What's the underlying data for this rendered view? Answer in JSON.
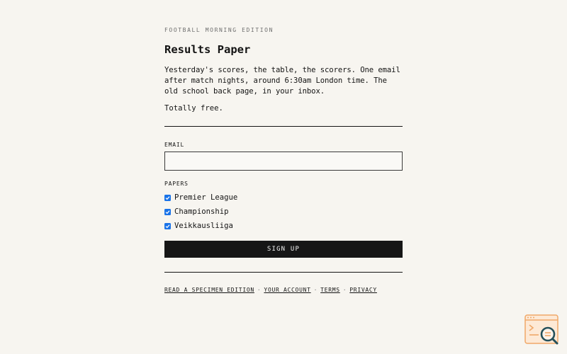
{
  "header": {
    "kicker": "FOOTBALL MORNING EDITION",
    "title": "Results Paper",
    "lede": "Yesterday's scores, the table, the scorers. One email after match nights, around 6:30am London time. The old school back page, in your inbox.",
    "free_note": "Totally free."
  },
  "form": {
    "email_label": "EMAIL",
    "email_value": "",
    "email_placeholder": "",
    "papers_label": "PAPERS",
    "papers": [
      {
        "label": "Premier League",
        "checked": true
      },
      {
        "label": "Championship",
        "checked": true
      },
      {
        "label": "Veikkausliiga",
        "checked": true
      }
    ],
    "submit_label": "SIGN UP"
  },
  "footer": {
    "links": [
      "READ A SPECIMEN EDITION",
      "YOUR ACCOUNT",
      "TERMS",
      "PRIVACY"
    ],
    "separator": "·"
  },
  "colors": {
    "background": "#f7f5f0",
    "ink": "#141414",
    "button": "#161616",
    "checkbox": "#1a73e8",
    "badge_accent": "#f0a868"
  },
  "icons": {
    "badge": "site-search-badge-icon",
    "checkbox": "checkmark-icon"
  }
}
